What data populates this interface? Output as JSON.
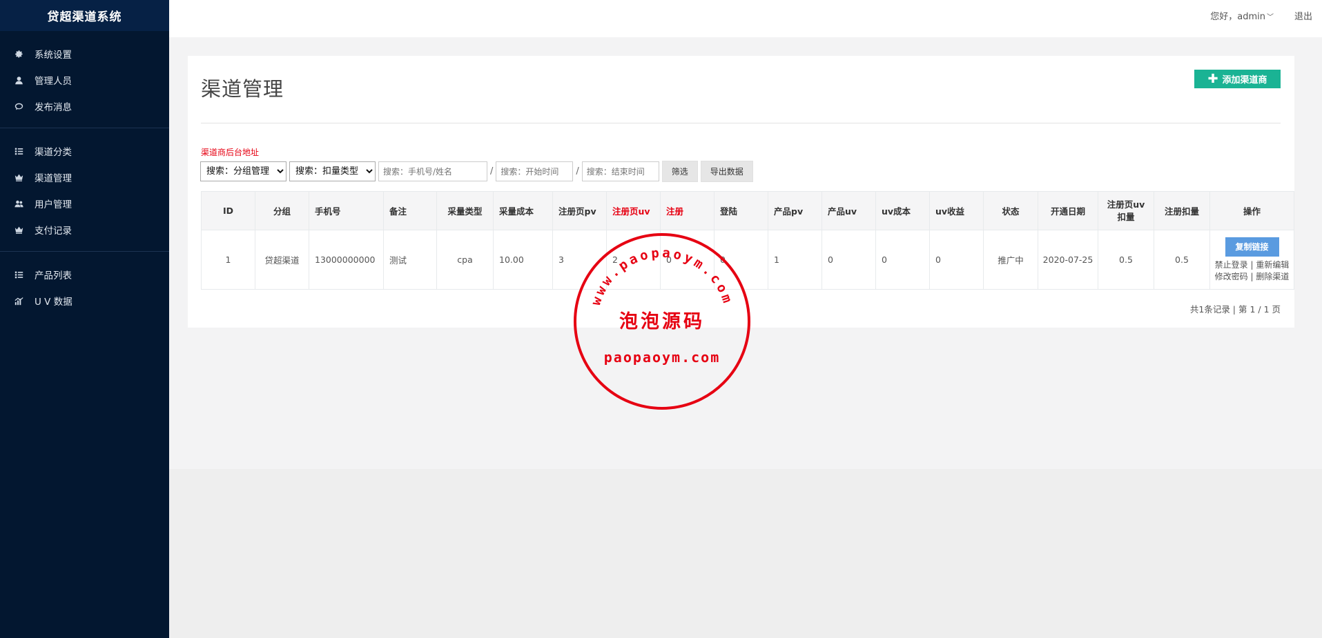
{
  "app": {
    "title": "贷超渠道系统"
  },
  "header": {
    "user": "您好，admin",
    "logout": "退出"
  },
  "sidebar": {
    "groups": [
      [
        {
          "label": "系统设置",
          "icon": "gear-icon"
        },
        {
          "label": "管理人员",
          "icon": "user-icon"
        },
        {
          "label": "发布消息",
          "icon": "comment-icon"
        }
      ],
      [
        {
          "label": "渠道分类",
          "icon": "list-icon"
        },
        {
          "label": "渠道管理",
          "icon": "crown-icon"
        },
        {
          "label": "用户管理",
          "icon": "users-icon"
        },
        {
          "label": "支付记录",
          "icon": "crown-icon"
        }
      ],
      [
        {
          "label": "产品列表",
          "icon": "list-icon"
        },
        {
          "label": "U V 数据",
          "icon": "bar-chart-icon"
        }
      ]
    ]
  },
  "page": {
    "title": "渠道管理",
    "add_button": "添加渠道商",
    "backend_link": "渠道商后台地址"
  },
  "filters": {
    "group_select": "搜索：分组管理",
    "type_select": "搜索：扣量类型",
    "phone_placeholder": "搜索：手机号/姓名",
    "start_placeholder": "搜索：开始时间",
    "end_placeholder": "搜索：结束时间",
    "separator": "/",
    "filter_button": "筛选",
    "export_button": "导出数据"
  },
  "table": {
    "headers": [
      "ID",
      "分组",
      "手机号",
      "备注",
      "采量类型",
      "采量成本",
      "注册页pv",
      "注册页uv",
      "注册",
      "登陆",
      "产品pv",
      "产品uv",
      "uv成本",
      "uv收益",
      "状态",
      "开通日期",
      "注册页uv\n扣量",
      "注册扣量",
      "操作"
    ],
    "red_headers": [
      "注册页uv",
      "注册"
    ],
    "rows": [
      {
        "id": "1",
        "group": "贷超渠道",
        "phone": "13000000000",
        "note": "测试",
        "type": "cpa",
        "cost": "10.00",
        "reg_pv": "3",
        "reg_uv": "2",
        "reg": "0",
        "login": "0",
        "prod_pv": "1",
        "prod_uv": "0",
        "uv_cost": "0",
        "uv_income": "0",
        "status": "推广中",
        "open_date": "2020-07-25",
        "reg_uv_deduct": "0.5",
        "reg_deduct": "0.5",
        "ops": {
          "copy": "复制链接",
          "ban": "禁止登录",
          "sep": " | ",
          "edit": "重新编辑",
          "pwd": "修改密码",
          "delete": "删除渠道"
        }
      }
    ]
  },
  "pager": {
    "text": "共1条记录 | 第 1 / 1 页"
  },
  "watermark": {
    "arc_text": "www.paopaoym.com",
    "center_text": "泡泡源码",
    "bottom_text": "paopaoym.com",
    "color": "#e60012"
  },
  "colors": {
    "sidebar": "#031730",
    "accent_green": "#1ab394",
    "accent_blue": "#5a9be0",
    "red": "#e60012"
  }
}
